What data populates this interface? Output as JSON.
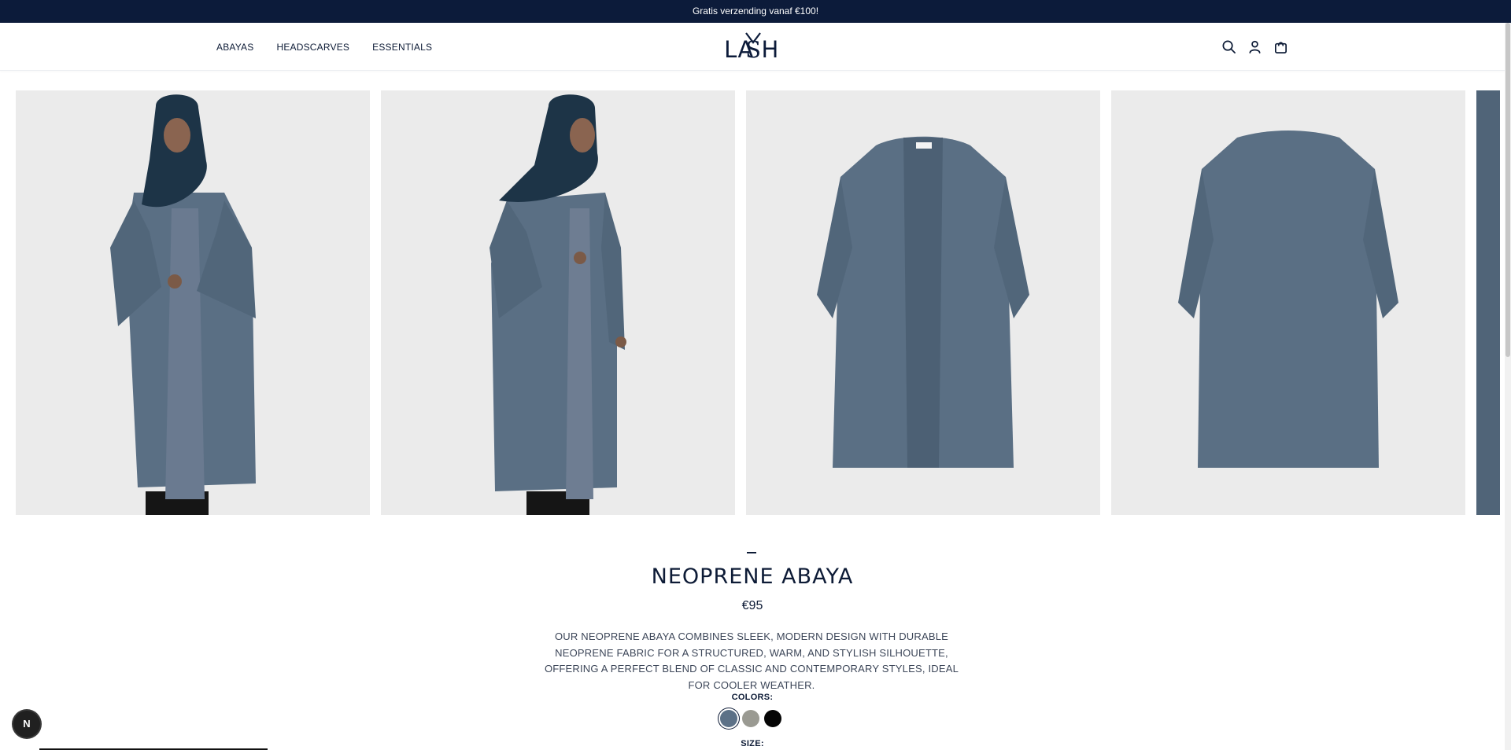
{
  "announcement": "Gratis verzending vanaf €100!",
  "nav": {
    "items": [
      "ABAYAS",
      "HEADSCARVES",
      "ESSENTIALS"
    ]
  },
  "logo": {
    "text": "LASAH"
  },
  "header_icons": [
    "search-icon",
    "account-icon",
    "cart-icon"
  ],
  "product": {
    "title": "NEOPRENE ABAYA",
    "price": "€95",
    "description": "OUR NEOPRENE ABAYA COMBINES SLEEK, MODERN DESIGN WITH DURABLE NEOPRENE FABRIC FOR A STRUCTURED, WARM, AND STYLISH SILHOUETTE, OFFERING A PERFECT BLEND OF CLASSIC AND CONTEMPORARY STYLES, IDEAL FOR COOLER WEATHER.",
    "colors_label": "COLORS:",
    "colors": [
      {
        "hex": "#5c7187",
        "selected": true
      },
      {
        "hex": "#9a9a92",
        "selected": false
      },
      {
        "hex": "#050505",
        "selected": false
      }
    ],
    "size_label": "SIZE:"
  },
  "gallery": {
    "image_count_visible": 5
  },
  "fab_label": "N",
  "colors": {
    "announcement_bg": "#0c1b3a",
    "text_primary": "#0d1b36",
    "photo_bg": "#ebebeb",
    "abaya": "#5c7187",
    "hijab": "#1d3447"
  }
}
